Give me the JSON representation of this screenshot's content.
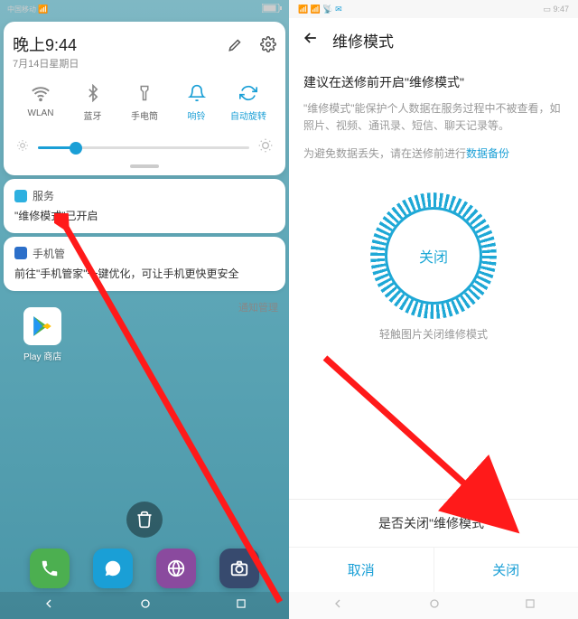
{
  "left": {
    "status": {
      "carrier": "中国移动",
      "battery_icon": "battery"
    },
    "panel": {
      "time": "晚上9:44",
      "date": "7月14日星期日",
      "qs": [
        {
          "name": "wifi",
          "label": "WLAN",
          "active": false
        },
        {
          "name": "bluetooth",
          "label": "蓝牙",
          "active": false
        },
        {
          "name": "flashlight",
          "label": "手电筒",
          "active": false
        },
        {
          "name": "ringer",
          "label": "响铃",
          "active": true
        },
        {
          "name": "autorotate",
          "label": "自动旋转",
          "active": true
        }
      ]
    },
    "notif1": {
      "app": "服务",
      "body": "\"维修模式\"已开启"
    },
    "notif2": {
      "app": "手机管",
      "body": "前往\"手机管家\"一键优化，可让手机更快更安全"
    },
    "notif_manage": "通知管理",
    "app_top_label": "Play 商店"
  },
  "right": {
    "status_time": "9:47",
    "title": "维修模式",
    "suggest_title": "建议在送修前开启\"维修模式\"",
    "suggest_text": "\"维修模式\"能保护个人数据在服务过程中不被查看，如照片、视频、通讯录、短信、聊天记录等。",
    "backup_prefix": "为避免数据丢失，请在送修前进行",
    "backup_link": "数据备份",
    "dial_label": "关闭",
    "dial_caption": "轻触图片关闭维修模式",
    "dialog_title": "是否关闭\"维修模式\"",
    "dialog_cancel": "取消",
    "dialog_confirm": "关闭"
  }
}
